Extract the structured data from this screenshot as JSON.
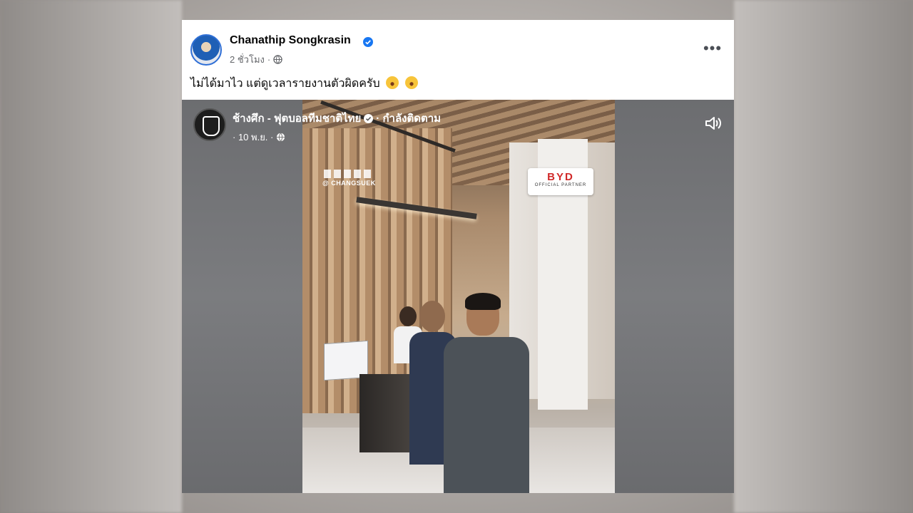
{
  "post": {
    "author": "Chanathip Songkrasin",
    "time": "2 ชั่วโมง",
    "separator": "·",
    "more_label": "•••",
    "caption": "ไม่ได้มาไว แต่ดูเวลารายงานตัวผิดครับ",
    "accent_color": "#1877f2"
  },
  "video": {
    "page_name": "ช้างศึก - ฟุตบอลทีมชาติไทย",
    "follow_status": "· กำลังติดตาม",
    "date": "· 10 พ.ย. ·",
    "watermark": "@ CHANGSUEK",
    "sign_brand": "BYD",
    "sign_text": "OFFICIAL PARTNER"
  },
  "icons": {
    "verified": "verified-badge-icon",
    "privacy": "globe-icon",
    "sound": "speaker-icon",
    "menu": "more-horizontal-icon"
  }
}
